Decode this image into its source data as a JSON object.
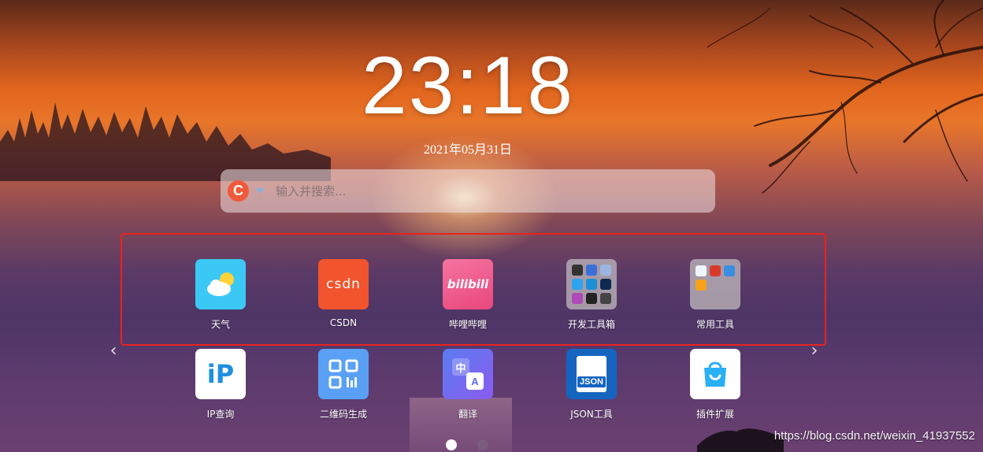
{
  "clock": {
    "time": "23:18",
    "date": "2021年05月31日"
  },
  "search": {
    "engine_letter": "C",
    "placeholder": "输入并搜索..."
  },
  "apps_row1": [
    {
      "label": "天气",
      "icon": "weather-icon"
    },
    {
      "label": "CSDN",
      "icon": "csdn-icon",
      "icon_text": "CSDN"
    },
    {
      "label": "哔哩哔哩",
      "icon": "bilibili-icon",
      "icon_text": "bilibili"
    },
    {
      "label": "开发工具箱",
      "icon": "dev-toolbox-folder-icon"
    },
    {
      "label": "常用工具",
      "icon": "common-tools-folder-icon"
    }
  ],
  "apps_row2": [
    {
      "label": "IP查询",
      "icon": "ip-lookup-icon",
      "icon_text": "iP"
    },
    {
      "label": "二维码生成",
      "icon": "qrcode-icon"
    },
    {
      "label": "翻译",
      "icon": "translate-icon",
      "icon_text_top": "中",
      "icon_text_bottom": "A"
    },
    {
      "label": "JSON工具",
      "icon": "json-icon",
      "icon_text": "JSON"
    },
    {
      "label": "插件扩展",
      "icon": "extension-store-icon"
    }
  ],
  "nav": {
    "prev": "‹",
    "next": "›"
  },
  "pagination": {
    "pages": 2,
    "active": 1
  },
  "watermark": "https://blog.csdn.net/weixin_41937552",
  "colors": {
    "highlight_border": "#e8231e",
    "csdn": "#f2542d",
    "bilibili": "#f25d8e",
    "weather": "#3cc8f5",
    "json": "#1565c0"
  }
}
